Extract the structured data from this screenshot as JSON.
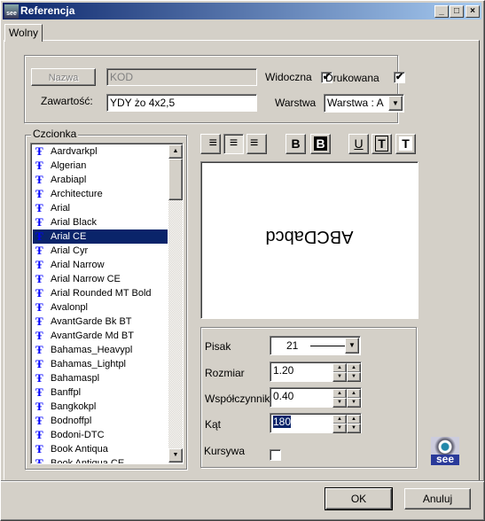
{
  "window": {
    "title": "Referencja",
    "minimize": "_",
    "maximize": "□",
    "close": "×"
  },
  "tabs": [
    {
      "label": "Wolny",
      "active": true
    }
  ],
  "top": {
    "name_button": "Nazwa",
    "name_value": "KOD",
    "visible_label": "Widoczna",
    "visible_checked": true,
    "printed_label": "Drukowana",
    "printed_checked": true,
    "content_label": "Zawartość:",
    "content_value": "YDY żo 4x2,5",
    "layer_label": "Warstwa",
    "layer_value": "Warstwa : A"
  },
  "font_group": {
    "label": "Czcionka",
    "selected": "Arial CE",
    "items": [
      "Aardvarkpl",
      "Algerian",
      "Arabiapl",
      "Architecture",
      "Arial",
      "Arial Black",
      "Arial CE",
      "Arial Cyr",
      "Arial Narrow",
      "Arial Narrow CE",
      "Arial Rounded MT Bold",
      "Avalonpl",
      "AvantGarde Bk BT",
      "AvantGarde Md BT",
      "Bahamas_Heavypl",
      "Bahamas_Lightpl",
      "Bahamaspl",
      "Banffpl",
      "Bangkokpl",
      "Bodnoffpl",
      "Bodoni-DTC",
      "Book Antiqua",
      "Book Antiqua CE"
    ]
  },
  "toolbar": {
    "align_right": "≡",
    "align_center": "≡",
    "align_left": "≡",
    "bold": "B",
    "bold_inverse": "B",
    "underline": "U",
    "framed": "T",
    "filled": "T",
    "active_align": "center"
  },
  "preview": {
    "text": "ABCDabcd",
    "rotation_deg": 180
  },
  "props": {
    "pen_label": "Pisak",
    "pen_value": "21",
    "size_label": "Rozmiar",
    "size_value": "1.20",
    "factor_label": "Współczynnik",
    "factor_value": "0.40",
    "angle_label": "Kąt",
    "angle_value": "180",
    "italic_label": "Kursywa",
    "italic_checked": false
  },
  "logo": "see",
  "buttons": {
    "ok": "OK",
    "cancel": "Anuluj"
  }
}
